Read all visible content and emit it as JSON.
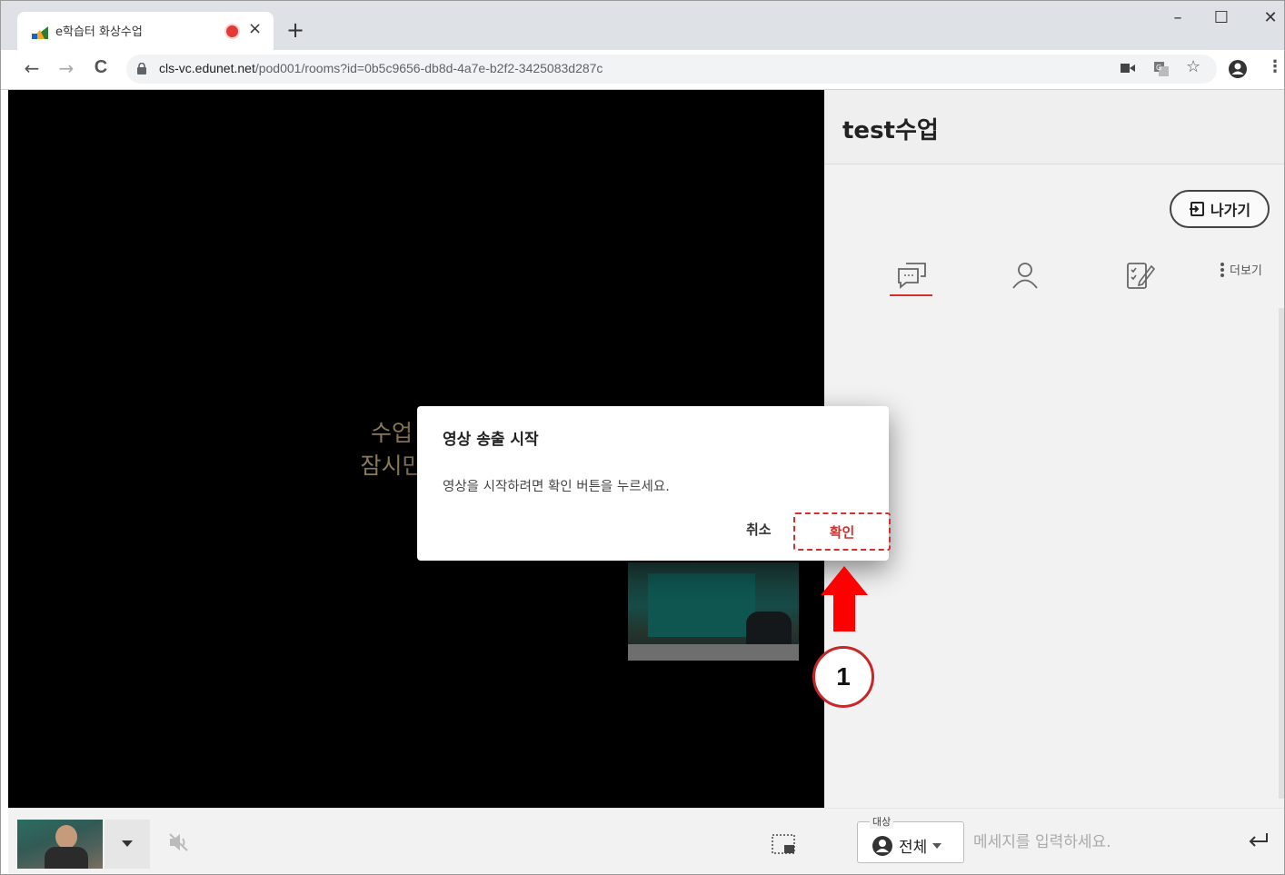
{
  "browser": {
    "tab_title": "e학습터 화상수업",
    "tab_close": "×",
    "new_tab": "+",
    "url_host": "cls-vc.edunet.net",
    "url_path": "/pod001/rooms?id=0b5c9656-db8d-4a7e-b2f2-3425083d287c",
    "window_controls": {
      "minimize": "–",
      "maximize": "☐",
      "close": "✕"
    },
    "nav": {
      "back": "←",
      "forward": "→",
      "reload": "C"
    },
    "toolbar_icons": [
      "camera-icon",
      "translate-icon",
      "bookmark-star-icon",
      "profile-icon",
      "menu-icon"
    ],
    "bookmark": "☆",
    "menu": "⋮"
  },
  "stage": {
    "wait_line1": "수업 중이",
    "wait_line2": "잠시만 기다"
  },
  "side_panel": {
    "title": "test수업",
    "exit_label": "나가기",
    "tabs": [
      "chat-icon",
      "participants-icon",
      "assignment-icon"
    ],
    "active_tab": "chat",
    "more_label": "더보기",
    "accent": "#d32f2f"
  },
  "bottom_bar": {
    "target_label": "대상",
    "target_value": "전체",
    "message_placeholder": "메세지를 입력하세요."
  },
  "dialog": {
    "title": "영상 송출 시작",
    "body": "영상을 시작하려면 확인 버튼을 누르세요.",
    "cancel": "취소",
    "confirm": "확인"
  },
  "annotation": {
    "step_number": "1",
    "arrow_color": "#ff0000"
  }
}
